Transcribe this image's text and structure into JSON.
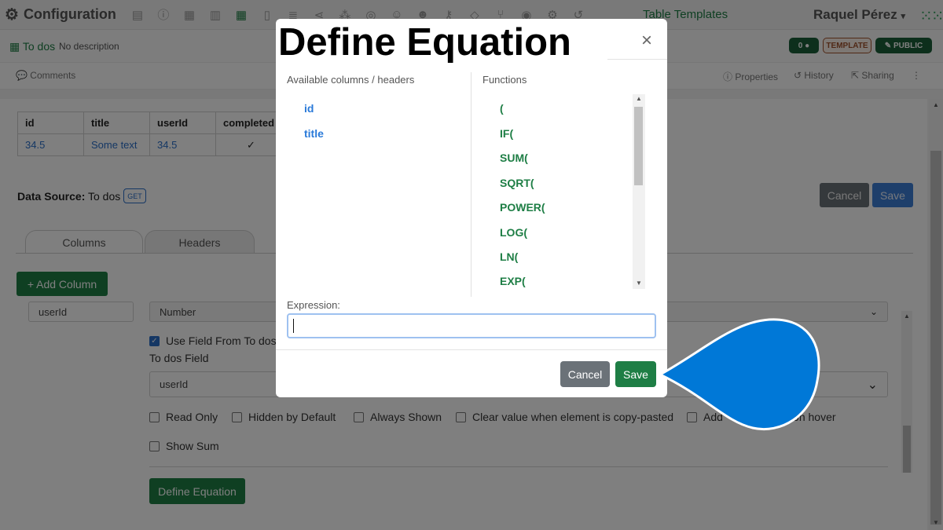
{
  "app": {
    "title": "Configuration",
    "templates_link": "Table Templates",
    "user_name": "Raquel Pérez",
    "user_caret": "▾"
  },
  "document": {
    "name": "To dos",
    "description": "No description",
    "count_badge": "0",
    "template_badge": "TEMPLATE",
    "public_badge": "PUBLIC"
  },
  "commentbar": {
    "comments": "Comments",
    "properties": "Properties",
    "history": "History",
    "sharing": "Sharing"
  },
  "preview_table": {
    "headers": [
      "id",
      "title",
      "userId",
      "completed"
    ],
    "row": [
      "34.5",
      "Some text",
      "34.5",
      "✓"
    ]
  },
  "data_source": {
    "label": "Data Source:",
    "value": "To dos",
    "method": "GET",
    "cancel": "Cancel",
    "save": "Save"
  },
  "tabs": {
    "columns": "Columns",
    "headers": "Headers"
  },
  "column_editor": {
    "add_column": "+ Add Column",
    "field_name": "userId",
    "field_type": "Number",
    "use_field_from": "Use Field From To dos",
    "to_dos_field_label": "To dos Field",
    "to_dos_field_value": "userId",
    "options": [
      "Read Only",
      "Hidden by Default",
      "Always Shown",
      "Clear value when element is copy-pasted",
      "Add",
      "data on hover"
    ],
    "show_sum": "Show Sum",
    "define_equation": "Define Equation"
  },
  "modal": {
    "title": "Define Equation",
    "close": "×",
    "available_columns_label": "Available columns / headers",
    "functions_label": "Functions",
    "columns": [
      "id",
      "title"
    ],
    "functions": [
      "(",
      "IF(",
      "SUM(",
      "SQRT(",
      "POWER(",
      "LOG(",
      "LN(",
      "EXP("
    ],
    "expression_label": "Expression:",
    "expression_value": "",
    "cancel": "Cancel",
    "save": "Save"
  },
  "colors": {
    "brand_green": "#1e7e45",
    "link_blue": "#2a7ad9",
    "pointer_blue": "#0078d7",
    "cancel_gray": "#6b7278"
  }
}
